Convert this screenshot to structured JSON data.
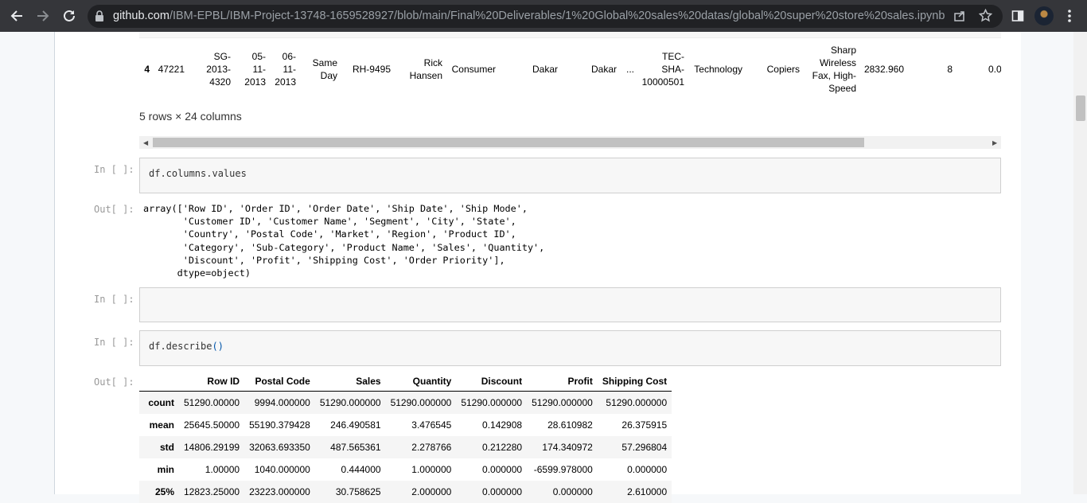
{
  "browser": {
    "url_host": "github.com",
    "url_path": "/IBM-EPBL/IBM-Project-13748-1659528927/blob/main/Final%20Deliverables/1%20Global%20sales%20datas/global%20super%20store%20sales.ipynb",
    "icons": [
      "back-arrow-icon",
      "forward-arrow-icon",
      "reload-icon",
      "lock-icon",
      "share-icon",
      "star-icon",
      "sidebar-icon",
      "avatar",
      "menu-dots-icon"
    ]
  },
  "notebook": {
    "partial_row": {
      "index": "4",
      "cells": [
        {
          "t": "47221"
        },
        {
          "t": "SG-\n2013-\n4320"
        },
        {
          "t": "05-\n11-\n2013"
        },
        {
          "t": "06-\n11-\n2013"
        },
        {
          "t": "Same\nDay"
        },
        {
          "t": "RH-9495"
        },
        {
          "t": "Rick\nHansen"
        },
        {
          "t": "Consumer"
        },
        {
          "t": "Dakar"
        },
        {
          "t": "Dakar"
        },
        {
          "t": "..."
        },
        {
          "t": "TEC-\nSHA-\n10000501"
        },
        {
          "t": "Technology"
        },
        {
          "t": "Copiers"
        },
        {
          "t": "Sharp\nWireless\nFax, High-\nSpeed"
        },
        {
          "t": "2832.960"
        },
        {
          "t": "8"
        },
        {
          "t": "0.0"
        }
      ]
    },
    "rows_info": "5 rows × 24 columns",
    "cell1": {
      "prompt": "In [ ]:",
      "code": "df.columns.values"
    },
    "out1": {
      "prompt": "Out[ ]:",
      "text": "array(['Row ID', 'Order ID', 'Order Date', 'Ship Date', 'Ship Mode',\n       'Customer ID', 'Customer Name', 'Segment', 'City', 'State',\n       'Country', 'Postal Code', 'Market', 'Region', 'Product ID',\n       'Category', 'Sub-Category', 'Product Name', 'Sales', 'Quantity',\n       'Discount', 'Profit', 'Shipping Cost', 'Order Priority'],\n      dtype=object)"
    },
    "cell2": {
      "prompt": "In [ ]:",
      "code": ""
    },
    "cell3": {
      "prompt": "In [ ]:",
      "code": "df.describe",
      "paren": "()"
    },
    "out3": {
      "prompt": "Out[ ]:",
      "columns": [
        "Row ID",
        "Postal Code",
        "Sales",
        "Quantity",
        "Discount",
        "Profit",
        "Shipping Cost"
      ],
      "rows": [
        {
          "label": "count",
          "values": [
            "51290.00000",
            "9994.000000",
            "51290.000000",
            "51290.000000",
            "51290.000000",
            "51290.000000",
            "51290.000000"
          ]
        },
        {
          "label": "mean",
          "values": [
            "25645.50000",
            "55190.379428",
            "246.490581",
            "3.476545",
            "0.142908",
            "28.610982",
            "26.375915"
          ]
        },
        {
          "label": "std",
          "values": [
            "14806.29199",
            "32063.693350",
            "487.565361",
            "2.278766",
            "0.212280",
            "174.340972",
            "57.296804"
          ]
        },
        {
          "label": "min",
          "values": [
            "1.00000",
            "1040.000000",
            "0.444000",
            "1.000000",
            "0.000000",
            "-6599.978000",
            "0.000000"
          ]
        },
        {
          "label": "25%",
          "values": [
            "12823.25000",
            "23223.000000",
            "30.758625",
            "2.000000",
            "0.000000",
            "0.000000",
            "2.610000"
          ]
        }
      ]
    }
  }
}
